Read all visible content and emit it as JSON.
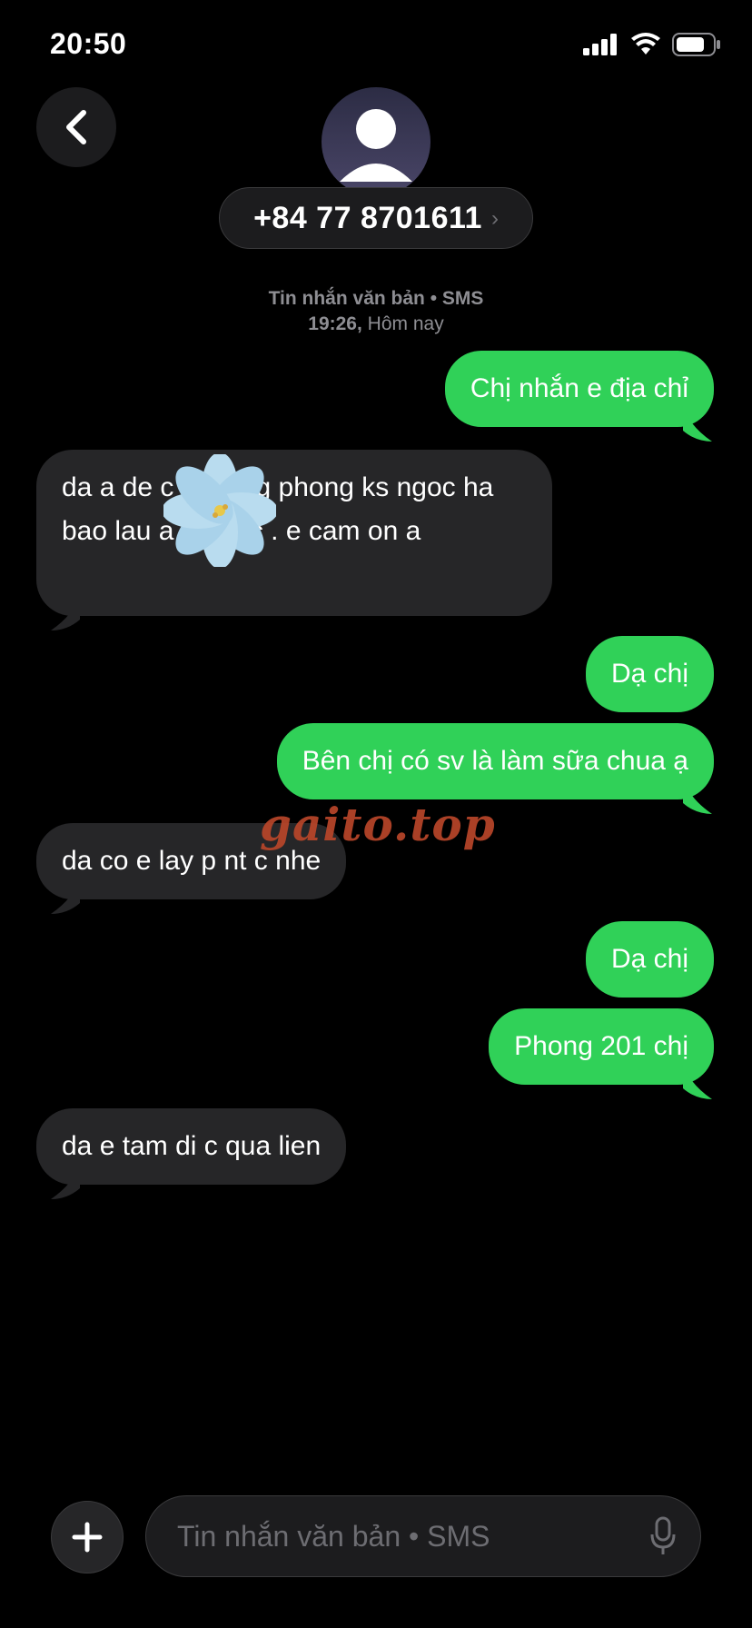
{
  "status_bar": {
    "time": "20:50"
  },
  "header": {
    "contact_number": "+84 77 8701611",
    "chevron": "›"
  },
  "meta": {
    "line1": "Tin nhắn văn bản • SMS",
    "line2_time": "19:26,",
    "line2_day": "Hôm nay"
  },
  "messages": [
    {
      "direction": "out",
      "text": "Chị nhắn e địa chỉ"
    },
    {
      "direction": "in",
      "text": "da a de      c le hong phong ks ngoc ha      bao lau a ghe dc . e cam on a"
    },
    {
      "direction": "out",
      "text": "Dạ chị"
    },
    {
      "direction": "out",
      "text": "Bên chị có sv là làm sữa chua ạ"
    },
    {
      "direction": "in",
      "text": "da co e lay p nt c nhe"
    },
    {
      "direction": "out",
      "text": "Dạ chị"
    },
    {
      "direction": "out",
      "text": "Phong 201 chị"
    },
    {
      "direction": "in",
      "text": "da e tam di c qua lien"
    }
  ],
  "watermark": "gaito.top",
  "input": {
    "placeholder": "Tin nhắn văn bản • SMS"
  },
  "colors": {
    "outgoing": "#30d158",
    "incoming": "#262628",
    "background": "#000000",
    "watermark": "#b9462a"
  },
  "icons": [
    "back-chevron-icon",
    "avatar-person-icon",
    "plus-icon",
    "microphone-icon",
    "signal-icon",
    "wifi-icon",
    "battery-icon",
    "flower-sticker"
  ]
}
